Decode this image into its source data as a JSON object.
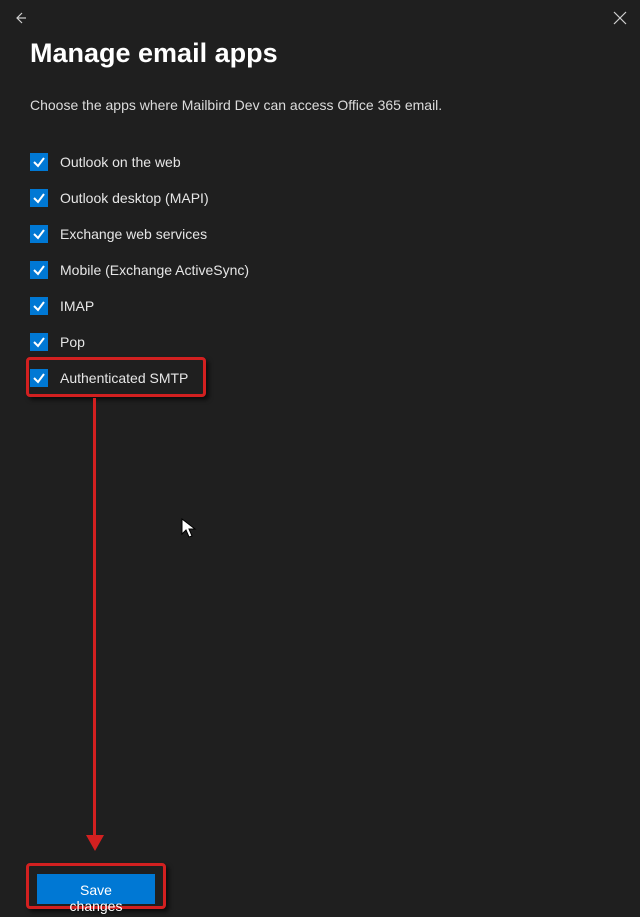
{
  "header": {
    "title": "Manage email apps",
    "description": "Choose the apps where Mailbird Dev can access Office 365 email."
  },
  "options": [
    {
      "label": "Outlook on the web"
    },
    {
      "label": "Outlook desktop (MAPI)"
    },
    {
      "label": "Exchange web services"
    },
    {
      "label": "Mobile (Exchange ActiveSync)"
    },
    {
      "label": "IMAP"
    },
    {
      "label": "Pop"
    },
    {
      "label": "Authenticated SMTP"
    }
  ],
  "footer": {
    "save_label": "Save changes"
  }
}
